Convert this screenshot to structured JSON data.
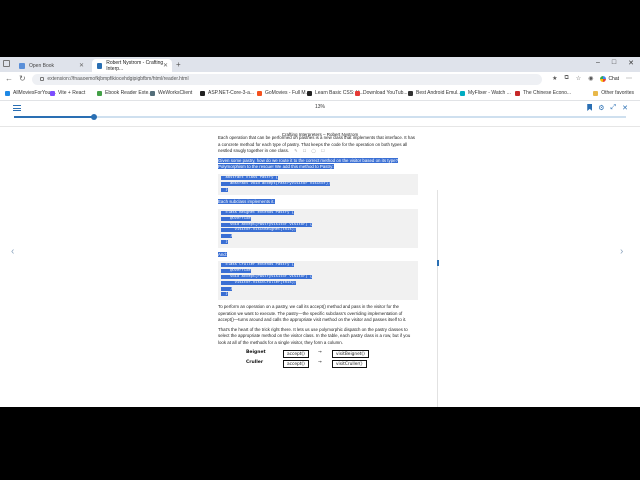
{
  "browser": {
    "tabs": [
      {
        "label": "Open Book",
        "active": false,
        "favicon_color": "#5a8fd8"
      },
      {
        "label": "Robert Nystrom - Crafting Interp...",
        "active": true,
        "favicon_color": "#2a6fb3"
      }
    ],
    "new_tab_symbol": "+",
    "window_controls": [
      "–",
      "□",
      "✕"
    ],
    "url": "extension://fnaaoemofkjbmpfikiocehdgipigbfbm/html/reader.html",
    "chat_label": "Chat",
    "bookmarks": [
      {
        "label": "AllMoviesForYou ...",
        "icon_color": "#1e88e5"
      },
      {
        "label": "Vite + React",
        "icon_color": "#7c4dff"
      },
      {
        "label": "Ebook Reader Exte...",
        "icon_color": "#43a047"
      },
      {
        "label": "WeWorksClient",
        "icon_color": "#546e7a"
      },
      {
        "label": "ASP.NET-Core-3-a...",
        "icon_color": "#222222"
      },
      {
        "label": "GoMovies - Full M...",
        "icon_color": "#f4511e"
      },
      {
        "label": "Learn Basic CSS: U...",
        "icon_color": "#222222"
      },
      {
        "label": "Download YouTub...",
        "icon_color": "#e53935"
      },
      {
        "label": "Best Android Emul...",
        "icon_color": "#333333"
      },
      {
        "label": "MyFlixer - Watch ...",
        "icon_color": "#00acc1"
      },
      {
        "label": "The Chinese Econo...",
        "icon_color": "#c62828"
      }
    ],
    "other_favorites": "Other favorites"
  },
  "reader": {
    "progress_percent": 13,
    "progress_label": "13%",
    "book_title": "Crafting Interpreters",
    "separator": "–",
    "author": "Robert Nystrom",
    "accent_color": "#2a6fb3",
    "highlight_color": "#3a6fd4"
  },
  "content": {
    "p1": "Each operation that can be performed on pastries is a new class that implements that interface. It has a concrete method for each type of pastry. That keeps the code for the operation on both types all nestled snugly together in one class.",
    "p1_icons": "✎ ☐ ◯ ☐",
    "p2": "Given some pastry, how do we route it to the correct method on the visitor based on its type? Polymorphism to the rescue! We add this method to Pastry:",
    "code1": "  abstract class Pastry {\n    abstract void accept(PastryVisitor visitor);\n  }",
    "p3": "Each subclass implements it.",
    "code2": "  class Beignet extends Pastry {\n    @Override\n    void accept(PastryVisitor visitor) {\n      visitor.visitBeignet(this);\n    }\n  }",
    "p4": "And:",
    "code3": "  class Cruller extends Pastry {\n    @Override\n    void accept(PastryVisitor visitor) {\n      visitor.visitCruller(this);\n    }\n  }",
    "p5": "To perform an operation on a pastry, we call its accept() method and pass in the visitor for the operation we want to execute. The pastry—the specific subclass's overriding implementation of accept()—turns around and calls the appropriate visit method on the visitor and passes itself to it.",
    "p6": "That's the heart of the trick right there. It lets us use polymorphic dispatch on the pastry classes to select the appropriate method on the visitor class. In the table, each pastry class is a row, but if you look at all of the methods for a single visitor, they form a column.",
    "diagram": {
      "rows": [
        {
          "label": "Beignet",
          "left": "accept()",
          "right": "visitBeignet()"
        },
        {
          "label": "Cruller",
          "left": "accept()",
          "right": "visitCruller()"
        }
      ],
      "arrow": "→"
    }
  },
  "nav": {
    "prev": "‹",
    "next": "›"
  }
}
